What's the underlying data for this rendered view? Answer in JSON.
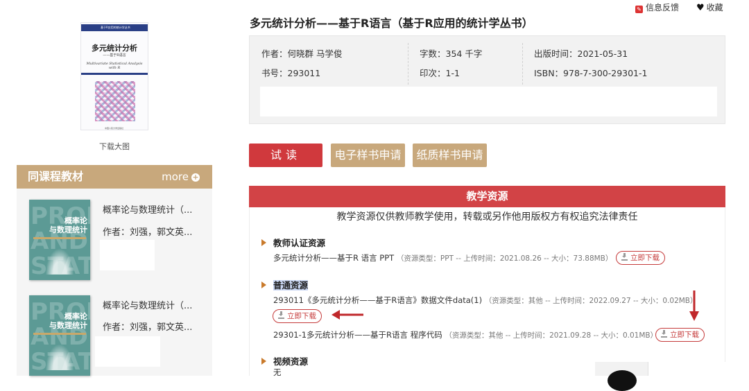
{
  "left": {
    "cover": {
      "series": "基于R应用的统计学丛书",
      "title": "多元统计分析",
      "subtitle": "——基于R语言",
      "english_title": "Multivariate Statistical Analysis with R",
      "publisher": "中国人民大学出版社"
    },
    "download_big": "下载大图",
    "same_course": {
      "title": "同课程教材",
      "more": "more",
      "books": [
        {
          "title": "概率论与数理统计（...",
          "author": "作者：刘强，郭文英...",
          "cover_text": "概率论\n与数理统计",
          "cover_bg": "PROB AND STAT"
        },
        {
          "title": "概率论与数理统计（...",
          "author": "作者：刘强，郭文英...",
          "cover_text": "概率论\n与数理统计",
          "cover_bg": "PROB AND STAT"
        }
      ]
    }
  },
  "top": {
    "feedback": "信息反馈",
    "favorite": "收藏"
  },
  "book": {
    "title": "多元统计分析——基于R语言（基于R应用的统计学丛书）",
    "author": "作者：何晓群 马学俊",
    "words": "字数：354 千字",
    "pub_date": "出版时间：2021-05-31",
    "book_no": "书号：293011",
    "print": "印次：1-1",
    "isbn": "ISBN：978-7-300-29301-1"
  },
  "actions": {
    "trial": "试读",
    "ebook": "电子样书申请",
    "paper": "纸质样书申请"
  },
  "resources": {
    "header": "教学资源",
    "notice": "教学资源仅供教师教学使用，转载或另作他用版权方有权追究法律责任",
    "download_label": "立即下载",
    "sections": [
      {
        "title": "教师认证资源",
        "files": [
          {
            "name": "多元统计分析——基于R 语言 PPT",
            "meta": "（资源类型：PPT -- 上传时间：2021.08.26 -- 大小：73.88MB）"
          }
        ]
      },
      {
        "title": "普通资源",
        "files": [
          {
            "name": "293011《多元统计分析——基于R语言》数据文件data(1)",
            "meta": "（资源类型：其他 -- 上传时间：2022.09.27 -- 大小：0.02MB）"
          },
          {
            "name": "29301-1多元统计分析——基于R语言 程序代码",
            "meta": "（资源类型：其他 -- 上传时间：2021.09.28 -- 大小：0.01MB）"
          }
        ]
      },
      {
        "title": "视频资源",
        "files": [],
        "empty": "无"
      }
    ]
  },
  "colors": {
    "accent_red": "#d24346",
    "tan": "#c8a87c",
    "annotation_arrow": "#c0282b"
  }
}
